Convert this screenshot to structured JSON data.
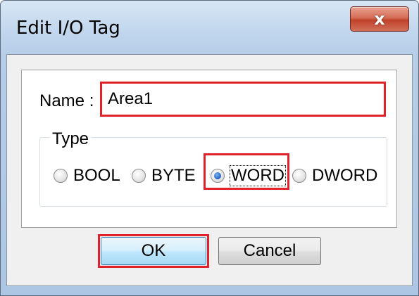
{
  "window": {
    "title": "Edit I/O Tag",
    "close_label": "x"
  },
  "form": {
    "name_label": "Name :",
    "name_value": "Area1",
    "type_legend": "Type",
    "type_options": [
      {
        "label": "BOOL",
        "selected": false
      },
      {
        "label": "BYTE",
        "selected": false
      },
      {
        "label": "WORD",
        "selected": true
      },
      {
        "label": "DWORD",
        "selected": false
      }
    ]
  },
  "buttons": {
    "ok_label": "OK",
    "cancel_label": "Cancel"
  },
  "colors": {
    "highlight": "#e0232a",
    "close_button": "#c1422a",
    "titlebar": "#c3d8ee"
  }
}
